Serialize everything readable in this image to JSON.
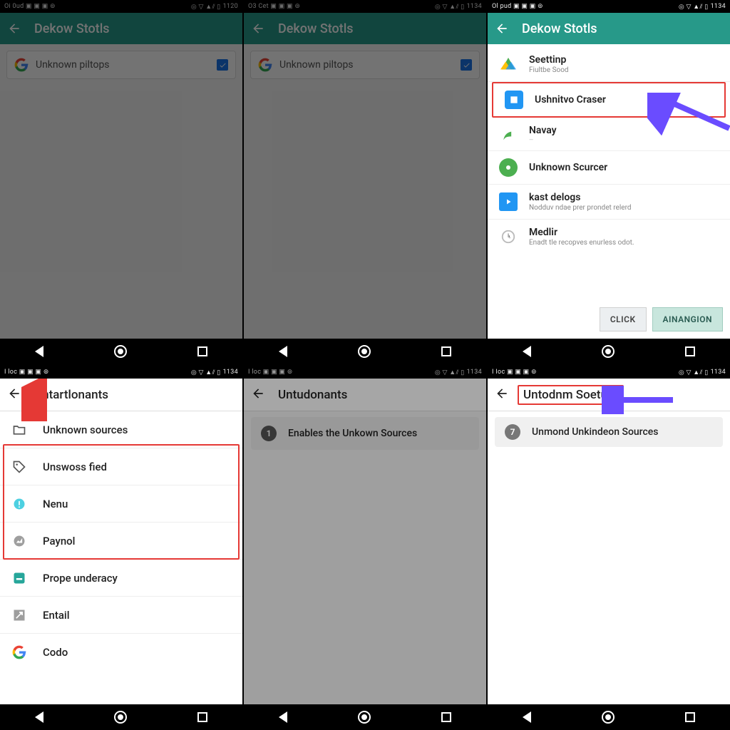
{
  "statusbar": {
    "left_text": [
      "Oi 0ud",
      "O3 Cet"
    ],
    "time": [
      "1120",
      "1134",
      "1134",
      "1134",
      "1134",
      "1134"
    ]
  },
  "appbar": {
    "title": "Dekow Stotls"
  },
  "search": {
    "placeholder": "Unknown piltops"
  },
  "panel3": {
    "items": [
      {
        "label": "Seettinp",
        "sub": "Fiultbe Sood"
      },
      {
        "label": "Ushnitvo Craser",
        "sub": ""
      },
      {
        "label": "Navay",
        "sub": ""
      },
      {
        "label": "Unknown Scurcer",
        "sub": ""
      },
      {
        "label": "kast delogs",
        "sub": "Nodduv ndae prer prondet relerd"
      },
      {
        "label": "Medlir",
        "sub": "Enadt tle recopves enurless odot."
      }
    ],
    "btn_click": "CLICK",
    "btn_go": "AINANGION"
  },
  "panel4": {
    "header": "Untartlonants",
    "items": [
      "Unknown sources",
      "Unswoss fied",
      "Nenu",
      "Paynol",
      "Prope underacy",
      "Entail",
      "Codo"
    ]
  },
  "panel5": {
    "header": "Untudonants",
    "item_num": "1",
    "item_label": "Enables the Unkown Sources"
  },
  "panel6": {
    "header": "Untodnm Soeturs",
    "item_num": "7",
    "item_label": "Unmond Unkindeon Sources"
  }
}
